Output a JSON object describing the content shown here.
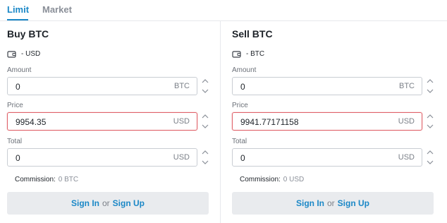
{
  "tabs": [
    {
      "label": "Limit",
      "active": true
    },
    {
      "label": "Market",
      "active": false
    }
  ],
  "colors": {
    "accent": "#1b88c7",
    "error_border": "#e0636b",
    "button_bg": "#e9ebee"
  },
  "buy": {
    "title": "Buy BTC",
    "wallet_text": "- USD",
    "amount": {
      "label": "Amount",
      "value": "0",
      "unit": "BTC"
    },
    "price": {
      "label": "Price",
      "value": "9954.35",
      "unit": "USD"
    },
    "total": {
      "label": "Total",
      "value": "0",
      "unit": "USD"
    },
    "commission_label": "Commission:",
    "commission_value": "0 BTC",
    "sign_in": "Sign In",
    "or": "or",
    "sign_up": "Sign Up"
  },
  "sell": {
    "title": "Sell BTC",
    "wallet_text": "- BTC",
    "amount": {
      "label": "Amount",
      "value": "0",
      "unit": "BTC"
    },
    "price": {
      "label": "Price",
      "value": "9941.77171158",
      "unit": "USD"
    },
    "total": {
      "label": "Total",
      "value": "0",
      "unit": "USD"
    },
    "commission_label": "Commission:",
    "commission_value": "0 USD",
    "sign_in": "Sign In",
    "or": "or",
    "sign_up": "Sign Up"
  },
  "icons": {
    "wallet": "wallet-icon",
    "stepper_up": "chevron-up-icon",
    "stepper_down": "chevron-down-icon"
  }
}
